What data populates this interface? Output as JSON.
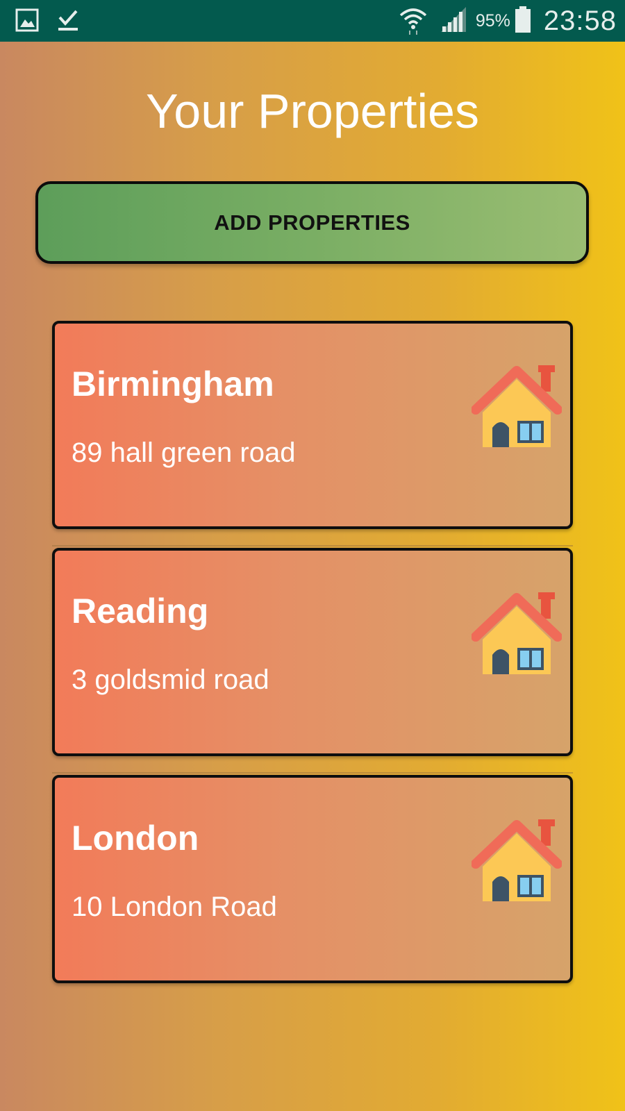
{
  "status_bar": {
    "battery_percent": "95%",
    "time": "23:58",
    "icons": [
      "gallery-icon",
      "check-download-icon",
      "wifi-icon",
      "signal-icon",
      "battery-icon"
    ]
  },
  "page": {
    "title": "Your Properties"
  },
  "add_button": {
    "label": "ADD PROPERTIES"
  },
  "properties": [
    {
      "city": "Birmingham",
      "address": "89 hall green road",
      "icon": "house-icon"
    },
    {
      "city": "Reading",
      "address": "3 goldsmid road",
      "icon": "house-icon"
    },
    {
      "city": "London",
      "address": "10 London Road",
      "icon": "house-icon"
    }
  ],
  "colors": {
    "status_bar": "#035a4e",
    "background_start": "#c98860",
    "background_end": "#f0c218",
    "button_start": "#5d9e5a",
    "button_end": "#9abd72",
    "card_start": "#f27b59",
    "card_end": "#d6a36a"
  }
}
